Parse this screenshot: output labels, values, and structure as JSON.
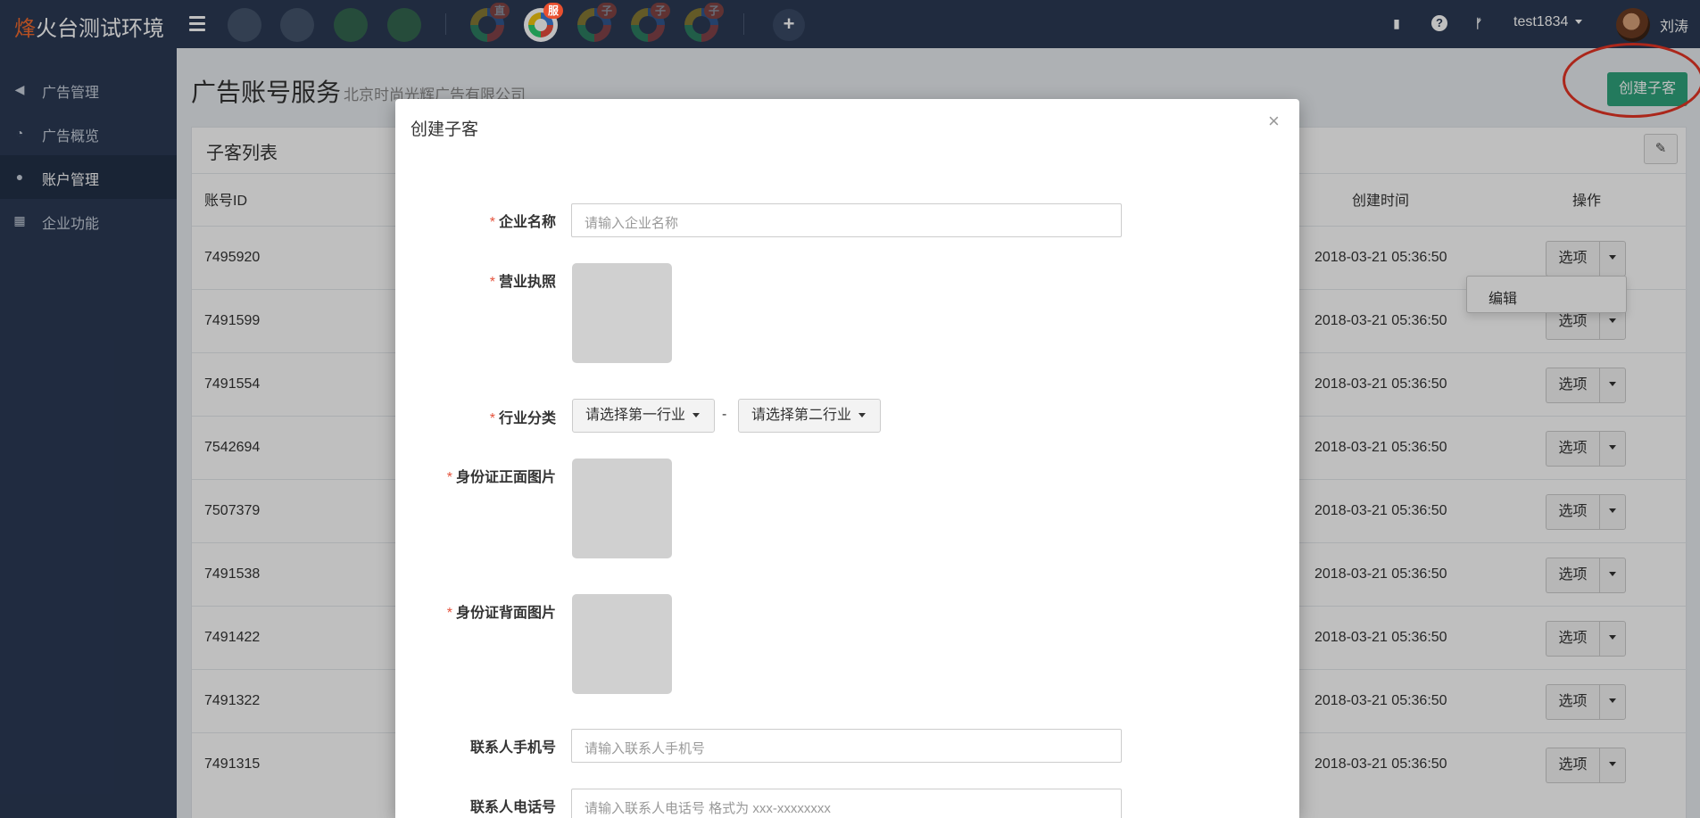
{
  "brand": {
    "accent_char": "烽",
    "rest": "火台测试环境"
  },
  "topbar": {
    "app_badges": [
      "直",
      "服",
      "子",
      "子",
      "子"
    ],
    "username": "test1834",
    "realname": "刘涛"
  },
  "sidebar": {
    "items": [
      {
        "label": "广告管理",
        "icon": "bullhorn-icon",
        "active": false
      },
      {
        "label": "广告概览",
        "icon": "dashboard-icon",
        "active": false
      },
      {
        "label": "账户管理",
        "icon": "user-icon",
        "active": true
      },
      {
        "label": "企业功能",
        "icon": "grid-icon",
        "active": false
      }
    ]
  },
  "page": {
    "title": "广告账号服务",
    "subtitle": "北京时尚光辉广告有限公司",
    "create_button": "创建子客"
  },
  "panel": {
    "title": "子客列表",
    "columns": {
      "id": "账号ID",
      "created": "创建时间",
      "action": "操作"
    },
    "option_label": "选项",
    "dropdown_item": "编辑",
    "rows": [
      {
        "id": "7495920",
        "created": "2018-03-21 05:36:50"
      },
      {
        "id": "7491599",
        "created": "2018-03-21 05:36:50"
      },
      {
        "id": "7491554",
        "created": "2018-03-21 05:36:50"
      },
      {
        "id": "7542694",
        "created": "2018-03-21 05:36:50"
      },
      {
        "id": "7507379",
        "created": "2018-03-21 05:36:50"
      },
      {
        "id": "7491538",
        "created": "2018-03-21 05:36:50"
      },
      {
        "id": "7491422",
        "created": "2018-03-21 05:36:50"
      },
      {
        "id": "7491322",
        "created": "2018-03-21 05:36:50"
      },
      {
        "id": "7491315",
        "created": "2018-03-21 05:36:50"
      }
    ]
  },
  "modal": {
    "title": "创建子客",
    "close": "×",
    "fields": {
      "company_name": {
        "label": "企业名称",
        "placeholder": "请输入企业名称"
      },
      "business_license": {
        "label": "营业执照"
      },
      "industry": {
        "label": "行业分类",
        "first": "请选择第一行业",
        "second": "请选择第二行业",
        "separator": "-"
      },
      "id_front": {
        "label": "身份证正面图片"
      },
      "id_back": {
        "label": "身份证背面图片"
      },
      "contact_mobile": {
        "label": "联系人手机号",
        "placeholder": "请输入联系人手机号"
      },
      "contact_phone": {
        "label": "联系人电话号",
        "placeholder": "请输入联系人电话号 格式为 xxx-xxxxxxxx"
      }
    },
    "required_mark": "*"
  },
  "colors": {
    "navbar": "#2b3a55",
    "primary": "#2fa37c",
    "badge": "#e8502f",
    "highlight_circle": "#e53525"
  }
}
